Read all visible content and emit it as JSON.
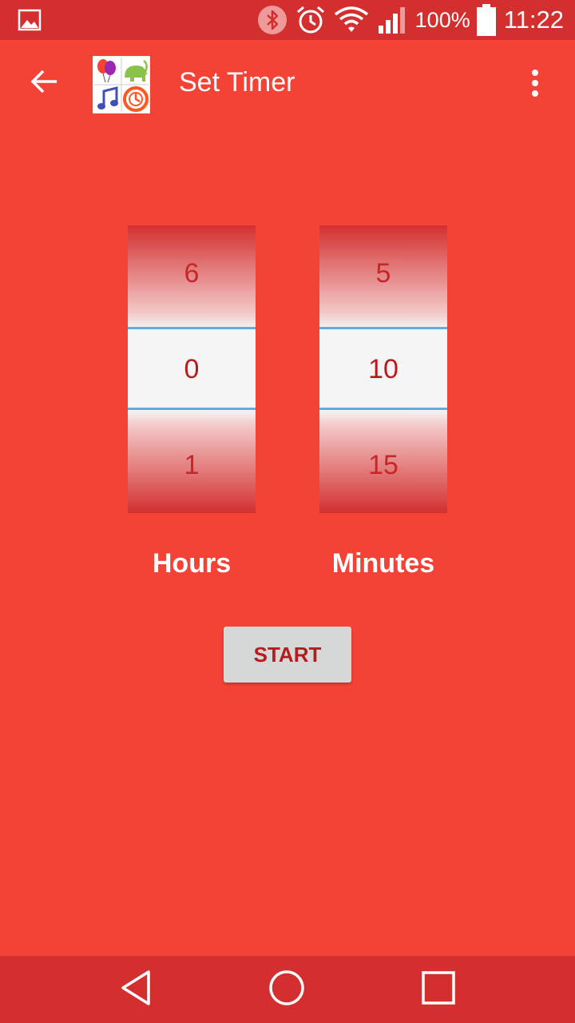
{
  "status_bar": {
    "battery_text": "100%",
    "time": "11:22",
    "icons": [
      "image-icon",
      "bluetooth-icon",
      "alarm-icon",
      "wifi-icon",
      "signal-icon",
      "battery-icon"
    ]
  },
  "app_bar": {
    "title": "Set Timer",
    "back_icon": "arrow-left-icon",
    "menu_icon": "more-vert-icon"
  },
  "hours_picker": {
    "label": "Hours",
    "above": "6",
    "selected": "0",
    "below": "1"
  },
  "minutes_picker": {
    "label": "Minutes",
    "above": "5",
    "selected": "10",
    "below": "15"
  },
  "start_button": {
    "label": "START"
  },
  "colors": {
    "primary": "#f44336",
    "primary_dark": "#d32f2f",
    "picker_text": "#c62828",
    "divider": "#64aadc",
    "button_bg": "#d6d7d7"
  }
}
